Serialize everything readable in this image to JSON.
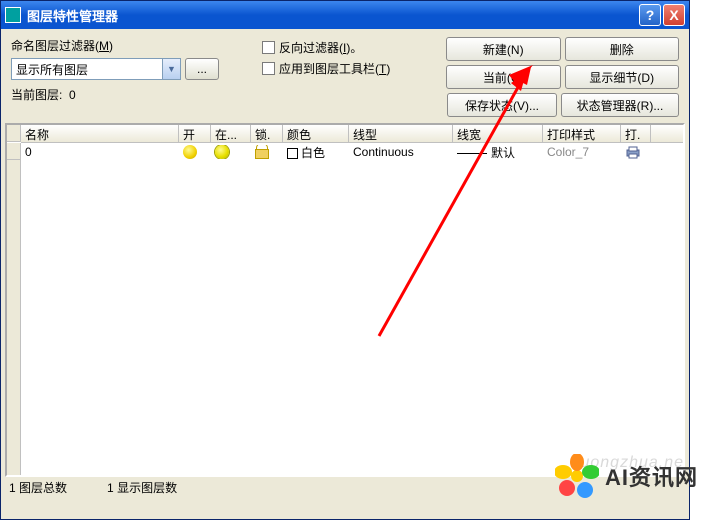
{
  "titlebar": {
    "title": "图层特性管理器",
    "help": "?",
    "close": "X"
  },
  "filter": {
    "label_pre": "命名图层过滤器(",
    "accel": "M",
    "label_post": ")",
    "combo_value": "显示所有图层",
    "browse": "..."
  },
  "options": {
    "invert_pre": "反向过滤器(",
    "invert_accel": "I",
    "invert_post": ")。",
    "apply_pre": "应用到图层工具栏(",
    "apply_accel": "T",
    "apply_post": ")"
  },
  "buttons": {
    "new": "新建(N)",
    "delete": "删除",
    "current": "当前(C)",
    "show_details": "显示细节(D)",
    "save_state": "保存状态(V)...",
    "state_mgr": "状态管理器(R)..."
  },
  "current_layer": {
    "label": "当前图层:",
    "value": "0"
  },
  "headers": {
    "name": "名称",
    "on": "开",
    "freeze": "在...",
    "lock": "锁.",
    "color": "颜色",
    "ltype": "线型",
    "lwt": "线宽",
    "pstyle": "打印样式",
    "plot": "打."
  },
  "rows": [
    {
      "name": "0",
      "color_label": "白色",
      "ltype": "Continuous",
      "lwt": "默认",
      "pstyle": "Color_7"
    }
  ],
  "status": {
    "total_pre": "1",
    "total_label": "图层总数",
    "shown_pre": "1",
    "shown_label": "显示图层数"
  },
  "watermark": {
    "text": "AI资讯网",
    "faded": "xuongzhua.ne"
  }
}
